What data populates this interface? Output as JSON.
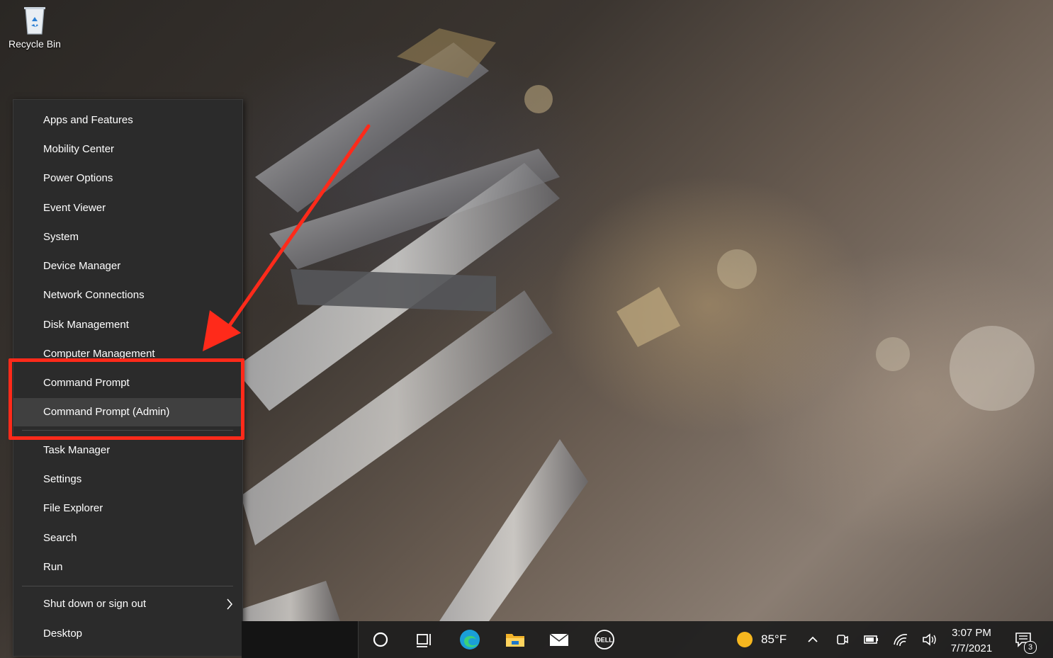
{
  "desktop": {
    "recycle_bin_label": "Recycle Bin"
  },
  "context_menu": {
    "items": [
      {
        "label": "Apps and Features"
      },
      {
        "label": "Mobility Center"
      },
      {
        "label": "Power Options"
      },
      {
        "label": "Event Viewer"
      },
      {
        "label": "System"
      },
      {
        "label": "Device Manager"
      },
      {
        "label": "Network Connections"
      },
      {
        "label": "Disk Management"
      },
      {
        "label": "Computer Management"
      },
      {
        "label": "Command Prompt"
      },
      {
        "label": "Command Prompt (Admin)"
      },
      {
        "label": "Task Manager"
      },
      {
        "label": "Settings"
      },
      {
        "label": "File Explorer"
      },
      {
        "label": "Search"
      },
      {
        "label": "Run"
      },
      {
        "label": "Shut down or sign out"
      },
      {
        "label": "Desktop"
      }
    ],
    "hovered_item": "Command Prompt (Admin)"
  },
  "annotation": {
    "color": "#ff2a1a",
    "highlight_target": "Command Prompt / Command Prompt (Admin)"
  },
  "taskbar": {
    "icons": [
      "cortana-circle-icon",
      "task-view-icon",
      "edge-icon",
      "file-explorer-icon",
      "mail-icon",
      "dell-icon"
    ],
    "weather": {
      "temperature": "85°F",
      "icon": "sun-icon"
    },
    "tray_icons": [
      "show-hidden-icons-chevron",
      "meet-now-icon",
      "battery-icon",
      "wifi-icon",
      "volume-icon"
    ],
    "clock": {
      "time": "3:07 PM",
      "date": "7/7/2021"
    },
    "notifications": {
      "count": "3"
    }
  }
}
